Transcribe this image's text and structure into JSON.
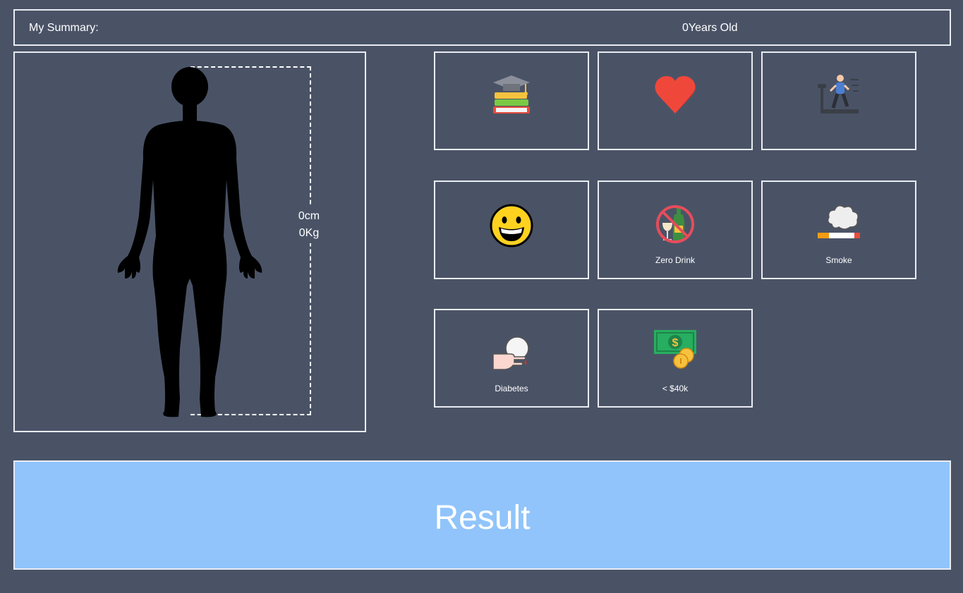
{
  "summary": {
    "label": "My Summary:",
    "age_text": "0Years Old"
  },
  "body": {
    "height_text": "0cm",
    "weight_text": "0Kg"
  },
  "tiles": [
    {
      "icon": "graduation-books-icon",
      "label": ""
    },
    {
      "icon": "heart-icon",
      "label": ""
    },
    {
      "icon": "treadmill-runner-icon",
      "label": ""
    },
    {
      "icon": "smiley-face-icon",
      "label": ""
    },
    {
      "icon": "no-alcohol-icon",
      "label": "Zero Drink"
    },
    {
      "icon": "cigarette-smoke-icon",
      "label": "Smoke"
    },
    {
      "icon": "blood-glucose-finger-icon",
      "label": "Diabetes"
    },
    {
      "icon": "money-coins-icon",
      "label": "< $40k"
    }
  ],
  "result": {
    "label": "Result"
  },
  "colors": {
    "background": "#4a5366",
    "border": "#e9ecf2",
    "result_button": "#90c4fb",
    "heart": "#f0473b"
  }
}
